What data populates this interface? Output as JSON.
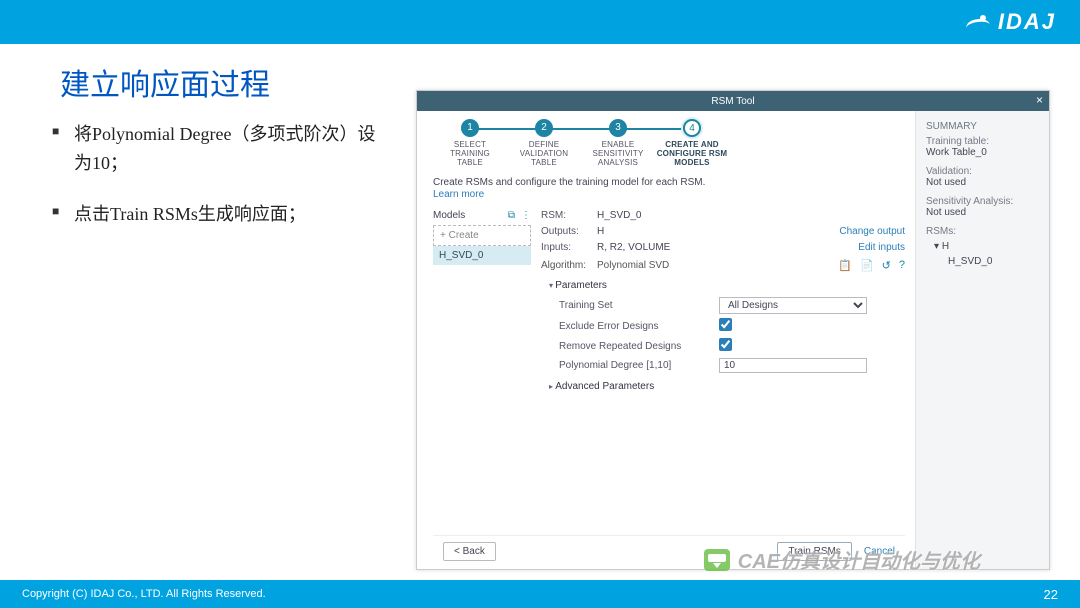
{
  "brand": "IDAJ",
  "slide": {
    "title": "建立响应面过程",
    "bullets": [
      "将Polynomial Degree（多项式阶次）设为10；",
      "点击Train RSMs生成响应面；"
    ],
    "copyright": "Copyright (C)  IDAJ Co., LTD. All Rights Reserved.",
    "page_number": "22"
  },
  "watermark": "CAE仿真设计自动化与优化",
  "tool": {
    "title": "RSM Tool",
    "close": "×",
    "steps": [
      {
        "num": "1",
        "label": "SELECT\nTRAINING\nTABLE"
      },
      {
        "num": "2",
        "label": "DEFINE\nVALIDATION\nTABLE"
      },
      {
        "num": "3",
        "label": "ENABLE\nSENSITIVITY\nANALYSIS"
      },
      {
        "num": "4",
        "label": "CREATE AND\nCONFIGURE RSM\nMODELS"
      }
    ],
    "active_step": 4,
    "desc": "Create RSMs and configure the training model for each RSM.",
    "learn_more": "Learn more",
    "models_header": "Models",
    "create_label": "+ Create",
    "models": [
      "H_SVD_0"
    ],
    "rsm": {
      "label_rsm": "RSM:",
      "name": "H_SVD_0",
      "label_outputs": "Outputs:",
      "outputs": "H",
      "change_output": "Change output",
      "label_inputs": "Inputs:",
      "inputs": "R, R2, VOLUME",
      "edit_inputs": "Edit inputs",
      "label_algorithm": "Algorithm:",
      "algorithm": "Polynomial SVD"
    },
    "params_header": "Parameters",
    "adv_header": "Advanced Parameters",
    "params": {
      "training_set_label": "Training Set",
      "training_set_value": "All Designs",
      "exclude_label": "Exclude Error Designs",
      "exclude_checked": true,
      "remove_label": "Remove Repeated Designs",
      "remove_checked": true,
      "degree_label": "Polynomial Degree [1,10]",
      "degree_value": "10"
    },
    "footer": {
      "back": "< Back",
      "train": "Train RSMs",
      "cancel": "Cancel"
    },
    "summary": {
      "header": "SUMMARY",
      "training_table_k": "Training table:",
      "training_table_v": "Work Table_0",
      "validation_k": "Validation:",
      "validation_v": "Not used",
      "sens_k": "Sensitivity Analysis:",
      "sens_v": "Not used",
      "rsms_k": "RSMs:",
      "tree_root": "H",
      "tree_child": "H_SVD_0"
    }
  }
}
